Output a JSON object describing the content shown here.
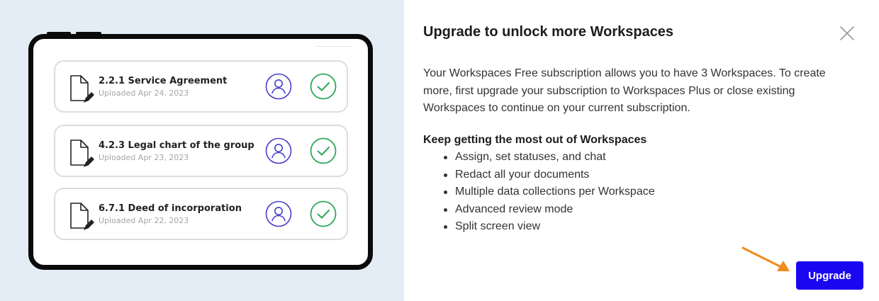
{
  "illustration": {
    "documents": [
      {
        "title": "2.2.1 Service Agreement",
        "date": "Uploaded Apr 24, 2023"
      },
      {
        "title": "4.2.3 Legal chart of the group",
        "date": "Uploaded Apr 23, 2023"
      },
      {
        "title": "6.7.1 Deed of incorporation",
        "date": "Uploaded Apr 22, 2023"
      }
    ],
    "icons": {
      "document": "document-edit-icon",
      "user": "user-circle-icon",
      "status": "check-circle-icon"
    }
  },
  "dialog": {
    "title": "Upgrade to unlock more Workspaces",
    "close_icon": "close-icon",
    "description": "Your Workspaces Free subscription allows you to have 3 Workspaces. To create more, first upgrade your subscription to Workspaces Plus or close existing Workspaces to continue on your current subscription.",
    "section_title": "Keep getting the most out of Workspaces",
    "features": [
      "Assign, set statuses, and chat",
      "Redact all your documents",
      "Multiple data collections per Workspace",
      "Advanced review mode",
      "Split screen view"
    ],
    "upgrade_label": "Upgrade"
  },
  "colors": {
    "left_background": "#e4edf5",
    "accent": "#1a06ef",
    "user_icon": "#4b3fc9",
    "check_icon": "#2fa65a",
    "arrow": "#f28c1c"
  }
}
